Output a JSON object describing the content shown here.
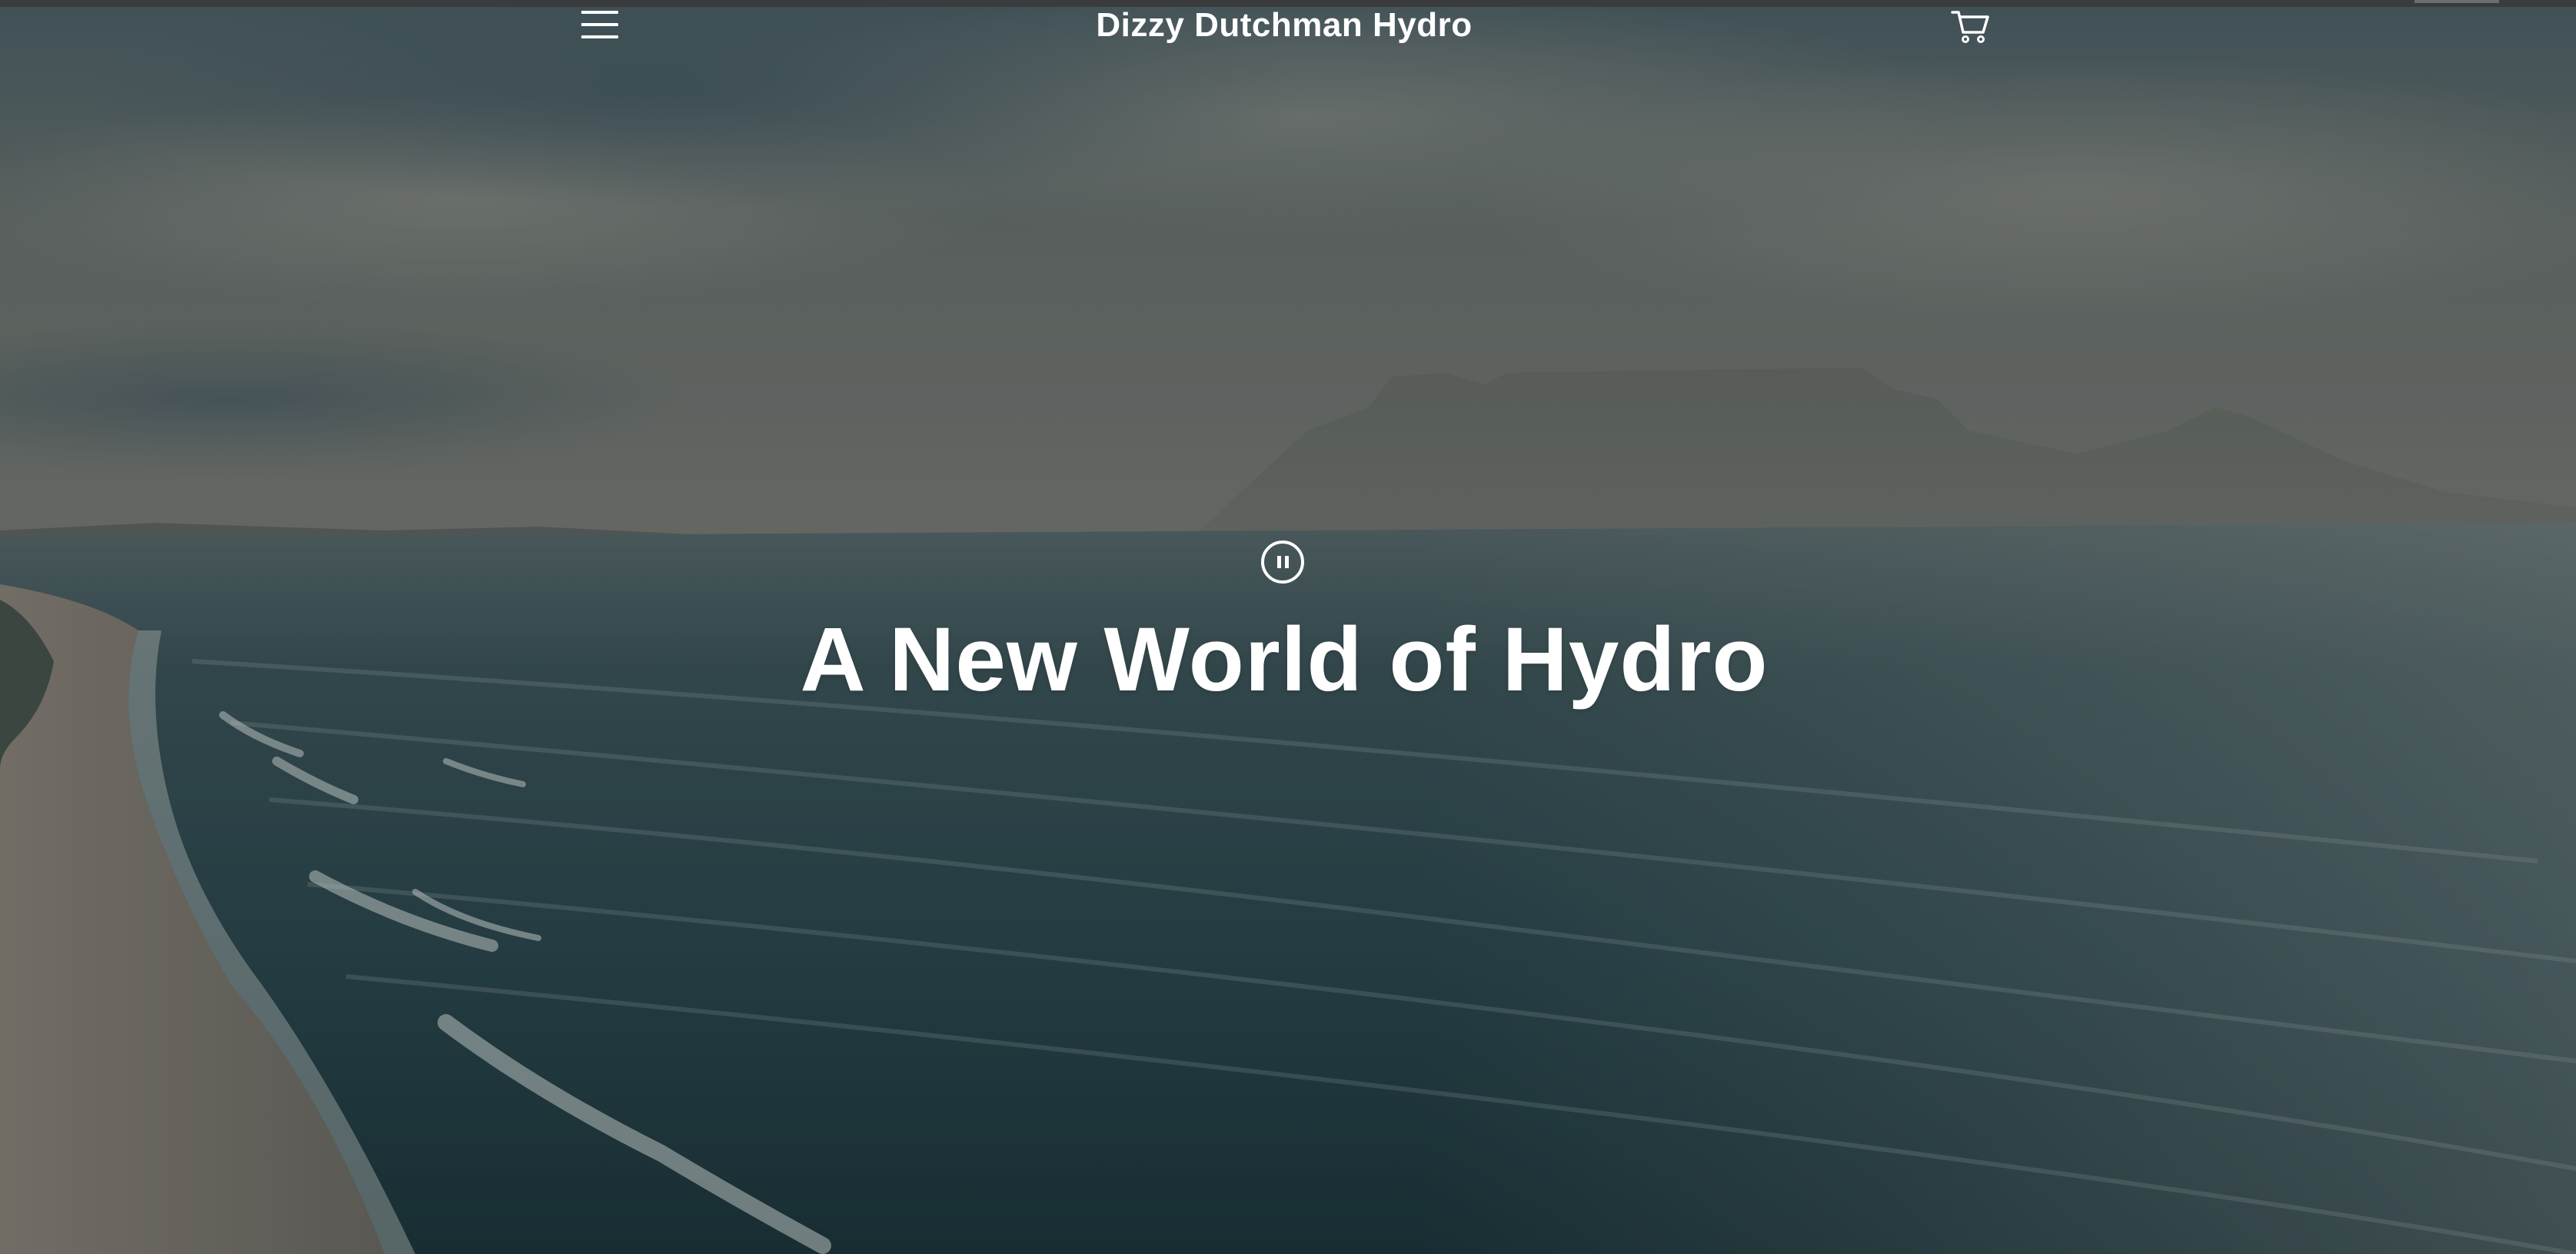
{
  "header": {
    "menu_icon": "hamburger-menu-icon",
    "site_title": "Dizzy Dutchman Hydro",
    "cart_icon": "shopping-cart-icon"
  },
  "hero": {
    "pause_icon": "pause-icon",
    "heading": "A New World of Hydro",
    "background": "aerial view of ocean coastline with misty mountain"
  },
  "colors": {
    "text": "#ffffff",
    "sea_dark": "#1f3a40",
    "sky": "#6e7a7a",
    "sand": "#8d8377",
    "browser_strip": "#3a3b3d"
  }
}
